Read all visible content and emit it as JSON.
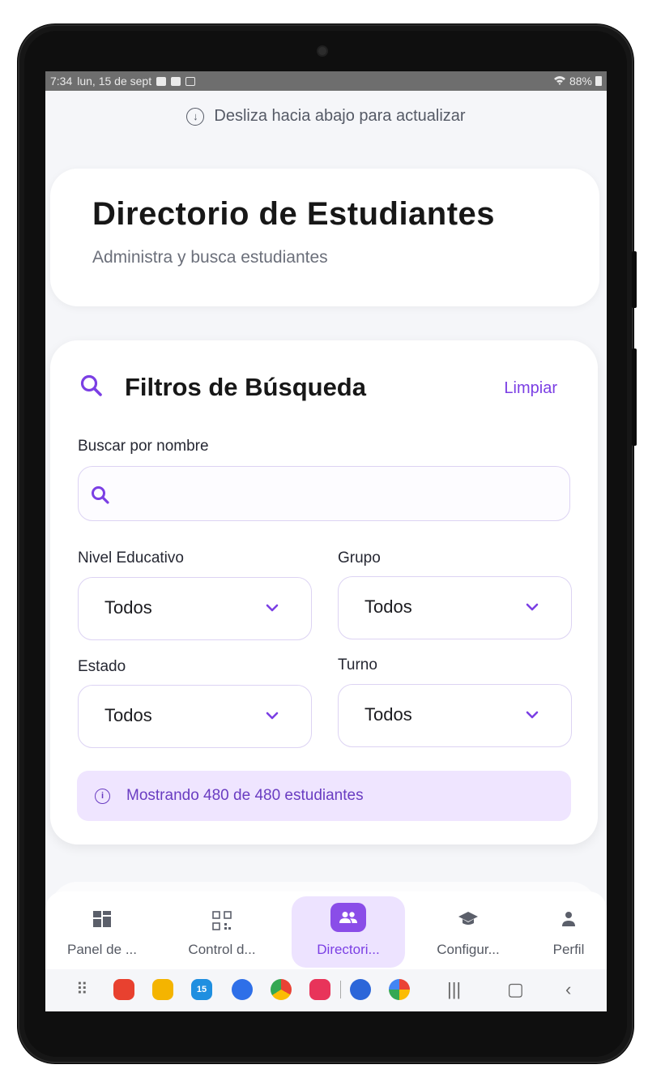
{
  "status_bar": {
    "time": "7:34",
    "date": "lun, 15 de sept",
    "battery": "88%"
  },
  "refresh_hint": "Desliza hacia abajo para actualizar",
  "header": {
    "title": "Directorio de Estudiantes",
    "subtitle": "Administra y busca estudiantes"
  },
  "filters": {
    "title": "Filtros de Búsqueda",
    "clear_label": "Limpiar",
    "search_label": "Buscar por nombre",
    "search_value": "",
    "nivel_label": "Nivel Educativo",
    "nivel_value": "Todos",
    "grupo_label": "Grupo",
    "grupo_value": "Todos",
    "estado_label": "Estado",
    "estado_value": "Todos",
    "turno_label": "Turno",
    "turno_value": "Todos",
    "results_text": "Mostrando 480 de 480 estudiantes"
  },
  "bottom_nav": {
    "items": [
      {
        "label": "Panel de ...",
        "icon": "dashboard-icon"
      },
      {
        "label": "Control d...",
        "icon": "qr-code-icon"
      },
      {
        "label": "Directori...",
        "icon": "people-icon",
        "active": true
      },
      {
        "label": "Configur...",
        "icon": "graduation-cap-icon"
      },
      {
        "label": "Perfil",
        "icon": "person-icon"
      }
    ]
  },
  "android_nav": {
    "calendar_badge": "15"
  },
  "colors": {
    "accent": "#7b3fe4",
    "accent_light": "#ede3ff",
    "info_bg": "#efe5ff",
    "background": "#f5f6f9"
  }
}
